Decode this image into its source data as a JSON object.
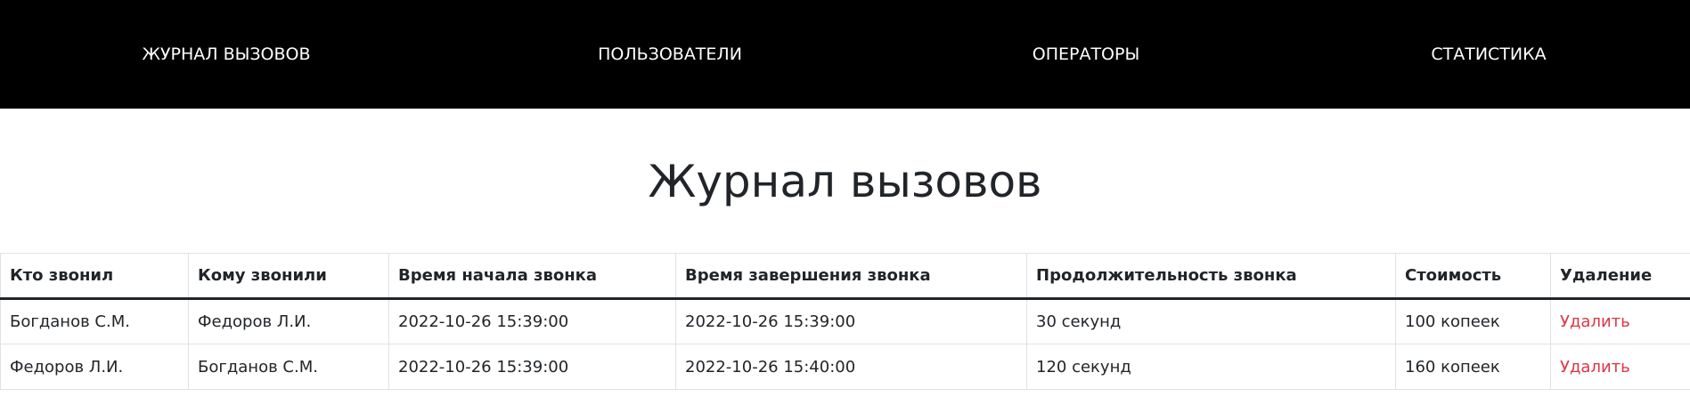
{
  "nav": {
    "items": [
      {
        "label": "ЖУРНАЛ ВЫЗОВОВ"
      },
      {
        "label": "ПОЛЬЗОВАТЕЛИ"
      },
      {
        "label": "ОПЕРАТОРЫ"
      },
      {
        "label": "СТАТИСТИКА"
      }
    ]
  },
  "page": {
    "title": "Журнал вызовов"
  },
  "table": {
    "headers": [
      "Кто звонил",
      "Кому звонили",
      "Время начала звонка",
      "Время завершения звонка",
      "Продолжительность звонка",
      "Стоимость",
      "Удаление"
    ],
    "rows": [
      {
        "caller": "Богданов С.М.",
        "callee": "Федоров Л.И.",
        "start": "2022-10-26 15:39:00",
        "end": "2022-10-26 15:39:00",
        "duration": "30 секунд",
        "cost": "100 копеек",
        "delete_label": "Удалить"
      },
      {
        "caller": "Федоров Л.И.",
        "callee": "Богданов С.М.",
        "start": "2022-10-26 15:39:00",
        "end": "2022-10-26 15:40:00",
        "duration": "120 секунд",
        "cost": "160 копеек",
        "delete_label": "Удалить"
      }
    ]
  },
  "colors": {
    "nav_background": "#000000",
    "nav_text": "#ffffff",
    "delete_link": "#dc3545"
  }
}
